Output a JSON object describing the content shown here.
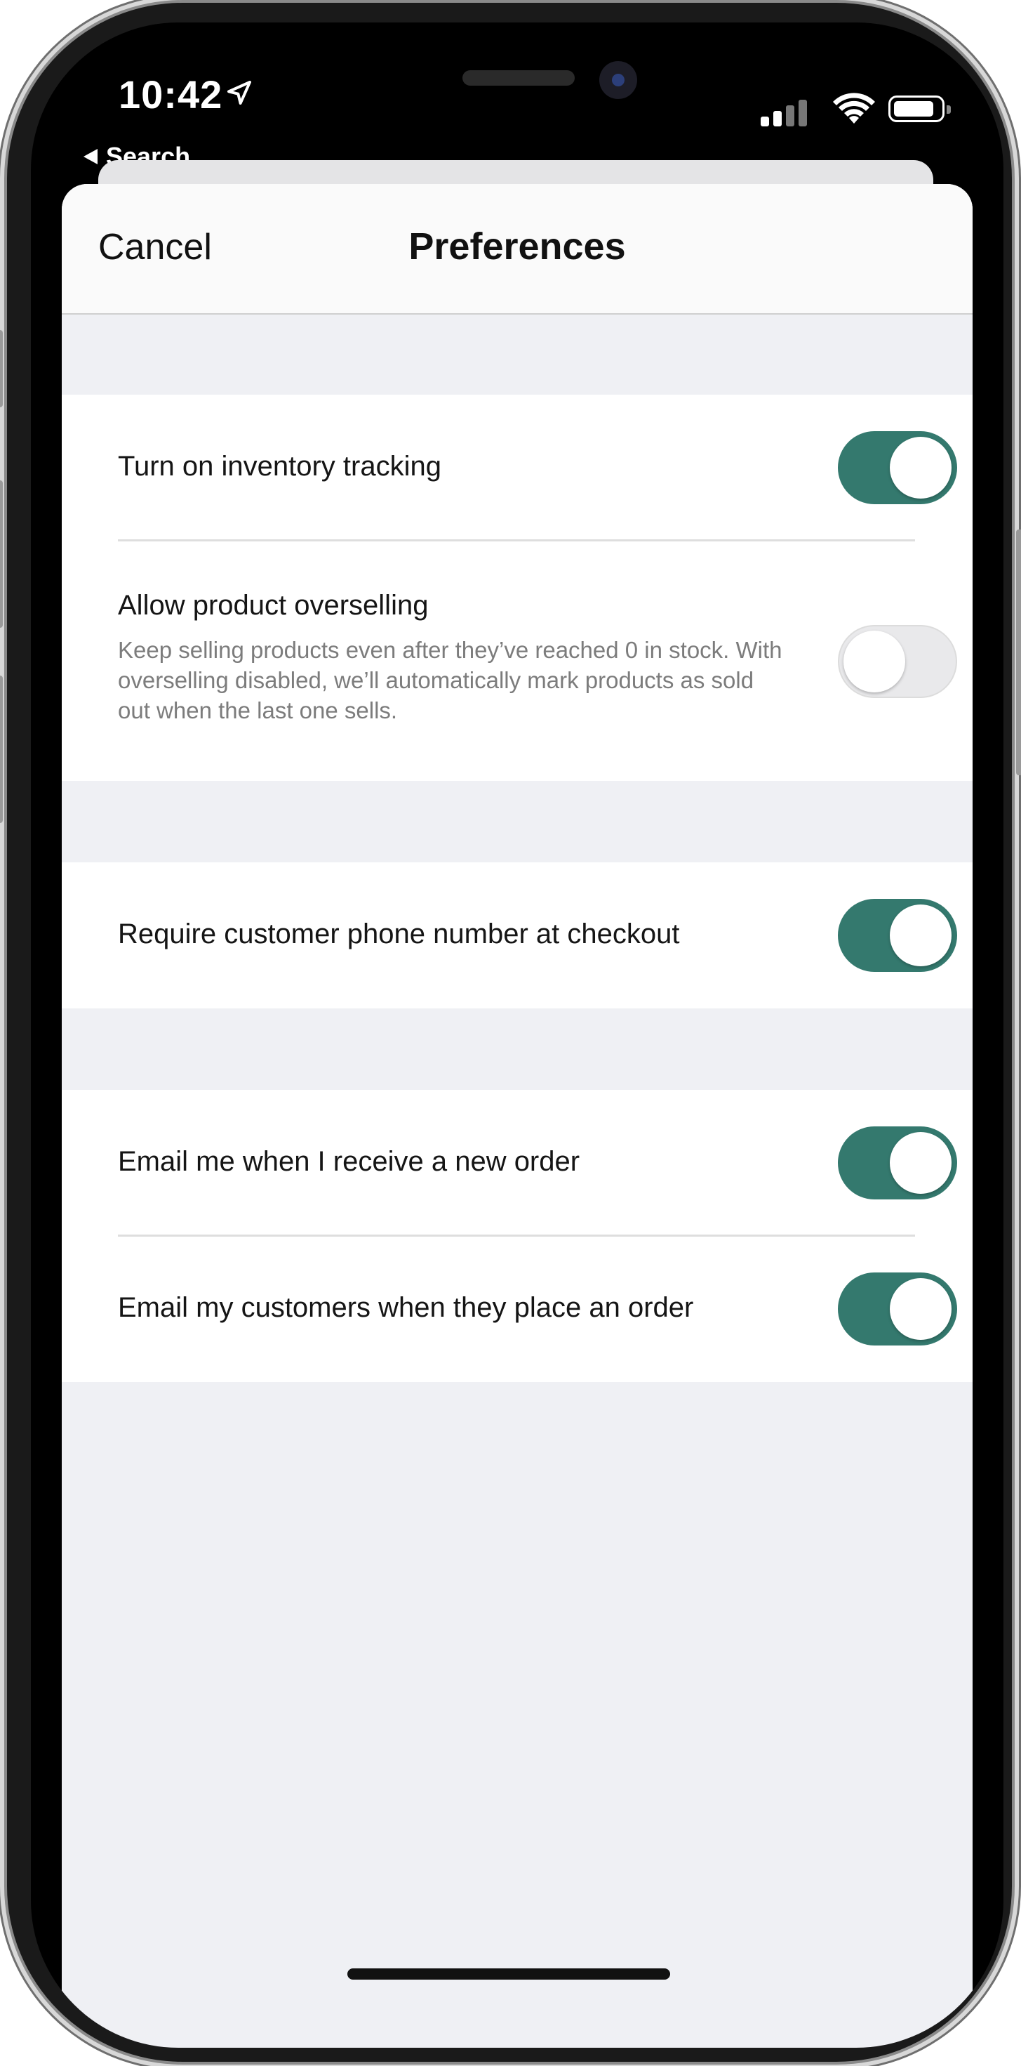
{
  "status_bar": {
    "time": "10:42",
    "back_label": "Search",
    "location_icon": "location-arrow-icon",
    "signal_icon": "cellular-signal-icon",
    "wifi_icon": "wifi-icon",
    "battery_icon": "battery-icon"
  },
  "nav": {
    "cancel_label": "Cancel",
    "title": "Preferences"
  },
  "settings": {
    "inventory_tracking": {
      "label": "Turn on inventory tracking",
      "enabled": true
    },
    "overselling": {
      "label": "Allow product overselling",
      "description": "Keep selling products even after they’ve reached 0 in stock. With overselling disabled, we’ll automatically mark products as sold out when the last one sells.",
      "enabled": false
    },
    "phone_required": {
      "label": "Require customer phone number at checkout",
      "enabled": true
    },
    "email_new_order": {
      "label": "Email me when I receive a new order",
      "enabled": true
    },
    "email_customers": {
      "label": "Email my customers when they place an order",
      "enabled": true
    }
  },
  "colors": {
    "toggle_on": "#34796e",
    "toggle_off": "#e9e9eb",
    "sheet_background": "#eff0f4",
    "group_background": "#ffffff"
  }
}
